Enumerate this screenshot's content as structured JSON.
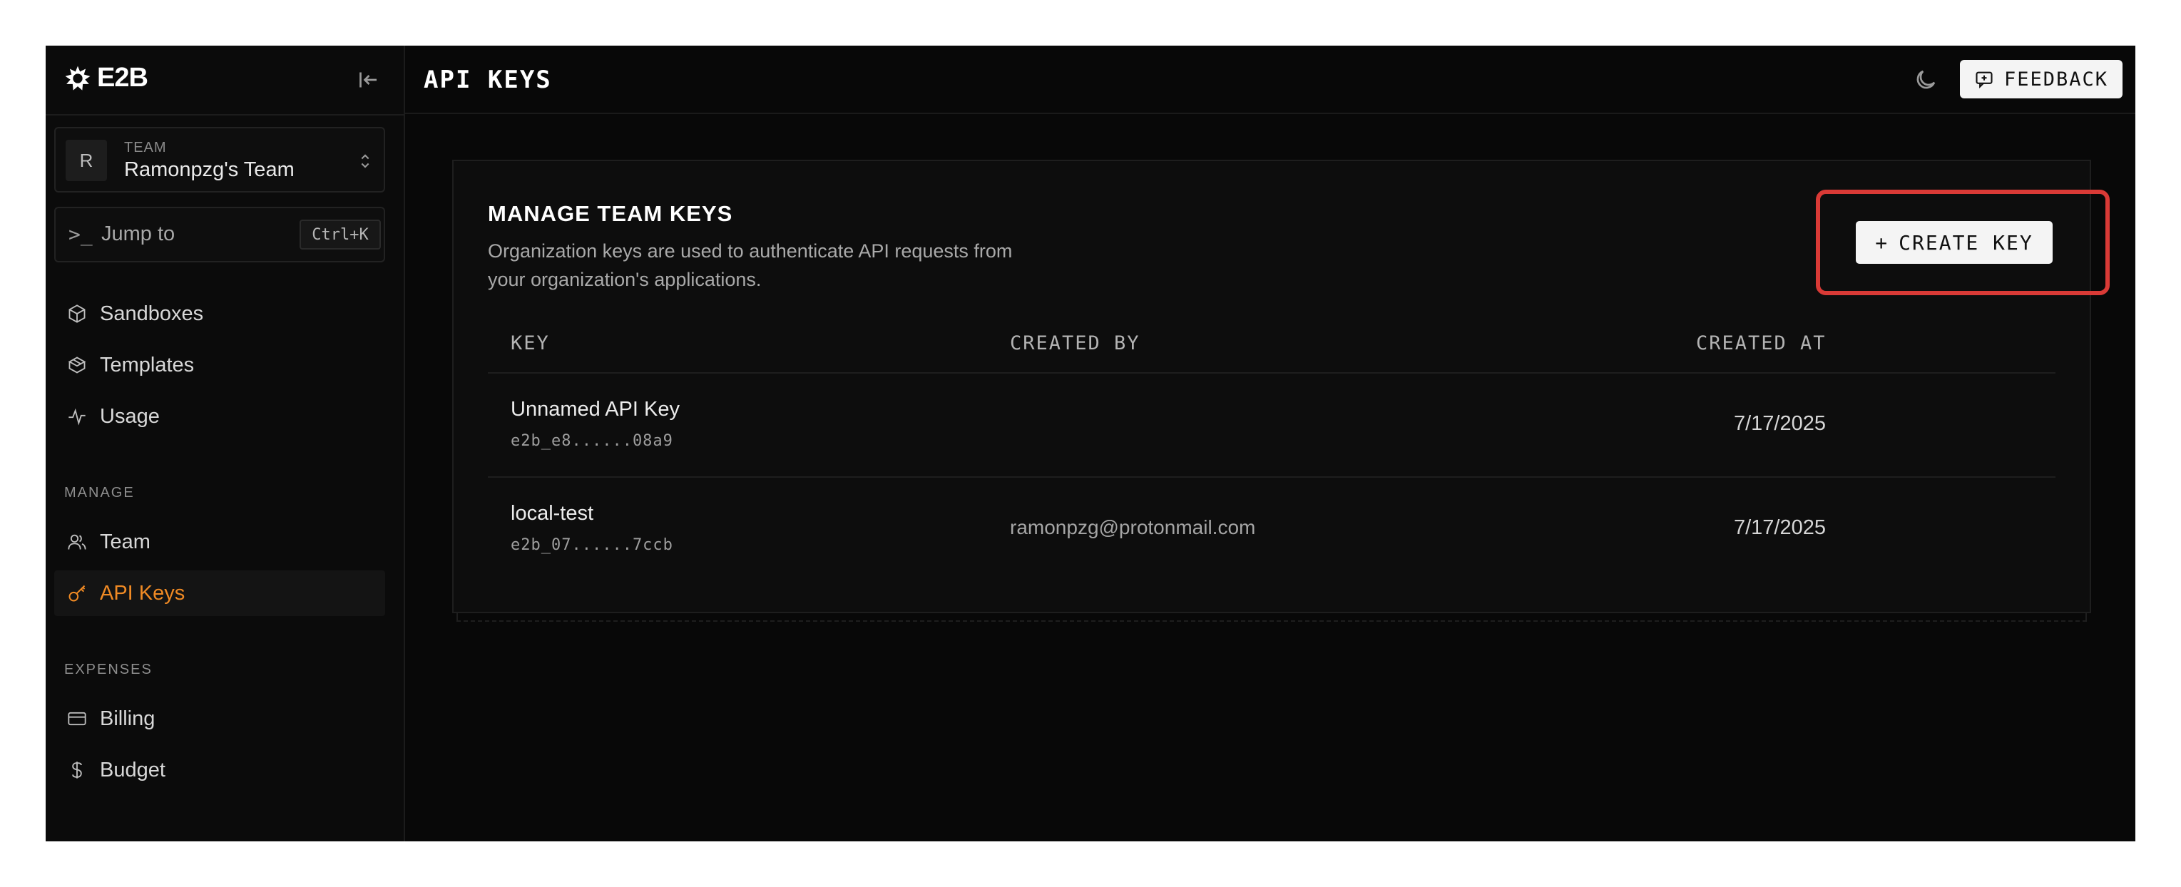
{
  "brand": {
    "name": "E2B"
  },
  "sidebar": {
    "team": {
      "initial": "R",
      "caption": "TEAM",
      "name": "Ramonpzg's Team"
    },
    "jump": {
      "label": "Jump to",
      "shortcut": "Ctrl+K"
    },
    "items": [
      {
        "label": "Sandboxes",
        "icon": "cube-icon"
      },
      {
        "label": "Templates",
        "icon": "box-icon"
      },
      {
        "label": "Usage",
        "icon": "activity-icon"
      }
    ],
    "manage_label": "MANAGE",
    "manage_items": [
      {
        "label": "Team",
        "icon": "users-icon"
      },
      {
        "label": "API Keys",
        "icon": "key-icon",
        "active": true
      }
    ],
    "expenses_label": "EXPENSES",
    "expenses_items": [
      {
        "label": "Billing",
        "icon": "credit-card-icon"
      },
      {
        "label": "Budget",
        "icon": "dollar-icon"
      }
    ]
  },
  "header": {
    "title": "API KEYS",
    "feedback_label": "FEEDBACK"
  },
  "card": {
    "title": "MANAGE TEAM KEYS",
    "description": "Organization keys are used to authenticate API requests from your organization's applications.",
    "create_label": "CREATE KEY",
    "columns": [
      "KEY",
      "CREATED BY",
      "CREATED AT"
    ],
    "rows": [
      {
        "name": "Unnamed API Key",
        "masked": "e2b_e8......08a9",
        "created_by": "",
        "created_at": "7/17/2025"
      },
      {
        "name": "local-test",
        "masked": "e2b_07......7ccb",
        "created_by": "ramonpzg@protonmail.com",
        "created_at": "7/17/2025"
      }
    ]
  },
  "colors": {
    "accent": "#f08a24",
    "highlight": "#d93a36",
    "background": "#080808"
  }
}
